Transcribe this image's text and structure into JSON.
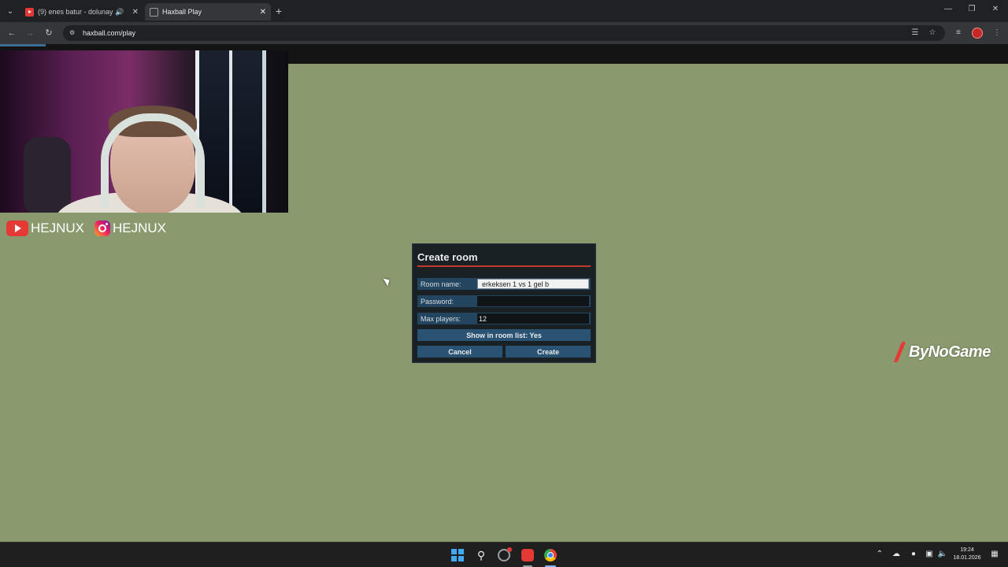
{
  "browser": {
    "tabs": [
      {
        "title": "(9) enes batur - dolunay c",
        "active": false,
        "audio": true
      },
      {
        "title": "Haxball Play",
        "active": true
      }
    ],
    "url": "haxball.com/play"
  },
  "overlay": {
    "youtube_handle": "HEJNUX",
    "instagram_handle": "HEJNUX",
    "watermark": "ByNoGame"
  },
  "dialog": {
    "title": "Create room",
    "room_name_label": "Room name:",
    "room_name_value": "erkeksen 1 vs 1 gel b",
    "password_label": "Password:",
    "password_value": "",
    "max_players_label": "Max players:",
    "max_players_value": "12",
    "show_in_list_label": "Show in room list: Yes",
    "cancel_label": "Cancel",
    "create_label": "Create"
  },
  "taskbar": {
    "time": "19:24",
    "date": "18.01.2026"
  },
  "colors": {
    "field_green": "#8a9a6e",
    "dialog_bg": "#1a2125",
    "button_blue": "#2a5373",
    "accent_red": "#c0392b"
  }
}
